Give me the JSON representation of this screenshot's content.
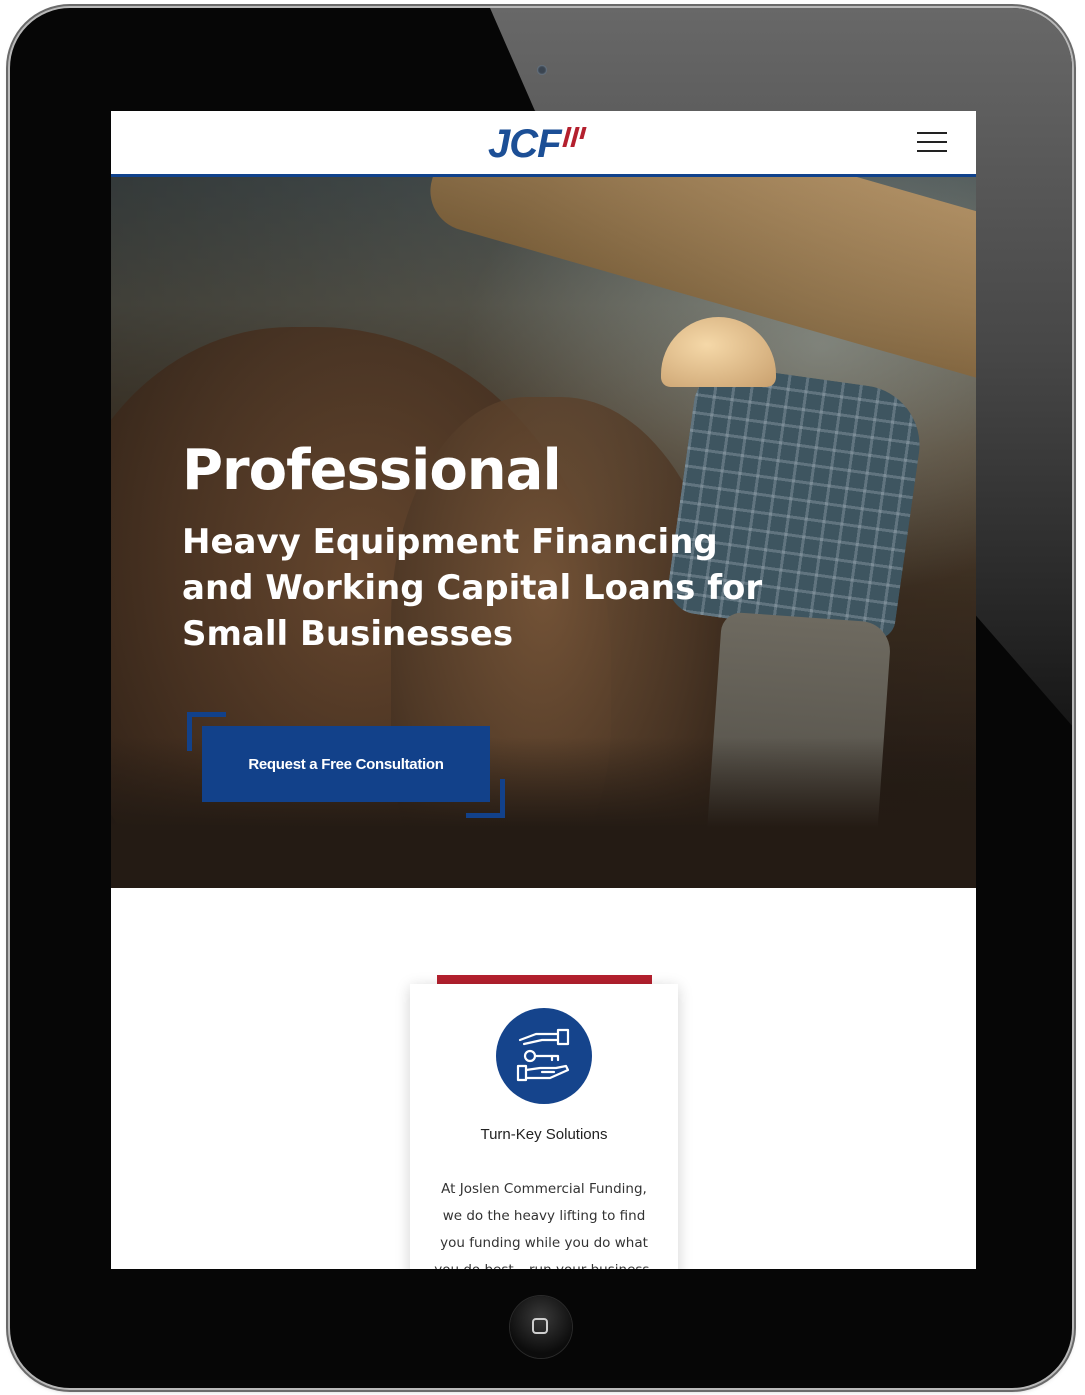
{
  "header": {
    "logo_text": "JCF",
    "menu_icon": "hamburger-menu-icon"
  },
  "hero": {
    "heading": "Professional",
    "subheading": "Heavy Equipment Financing and Working Capital Loans for Small Businesses",
    "cta_label": "Request a Free Consultation"
  },
  "feature_card": {
    "icon": "key-handoff-icon",
    "title": "Turn-Key Solutions",
    "text": "At Joslen Commercial Funding, we do the heavy lifting to find you funding while you do what you do best – run your business."
  },
  "colors": {
    "brand_blue": "#12418a",
    "brand_red": "#b4202e",
    "device_frame": "#060606"
  }
}
